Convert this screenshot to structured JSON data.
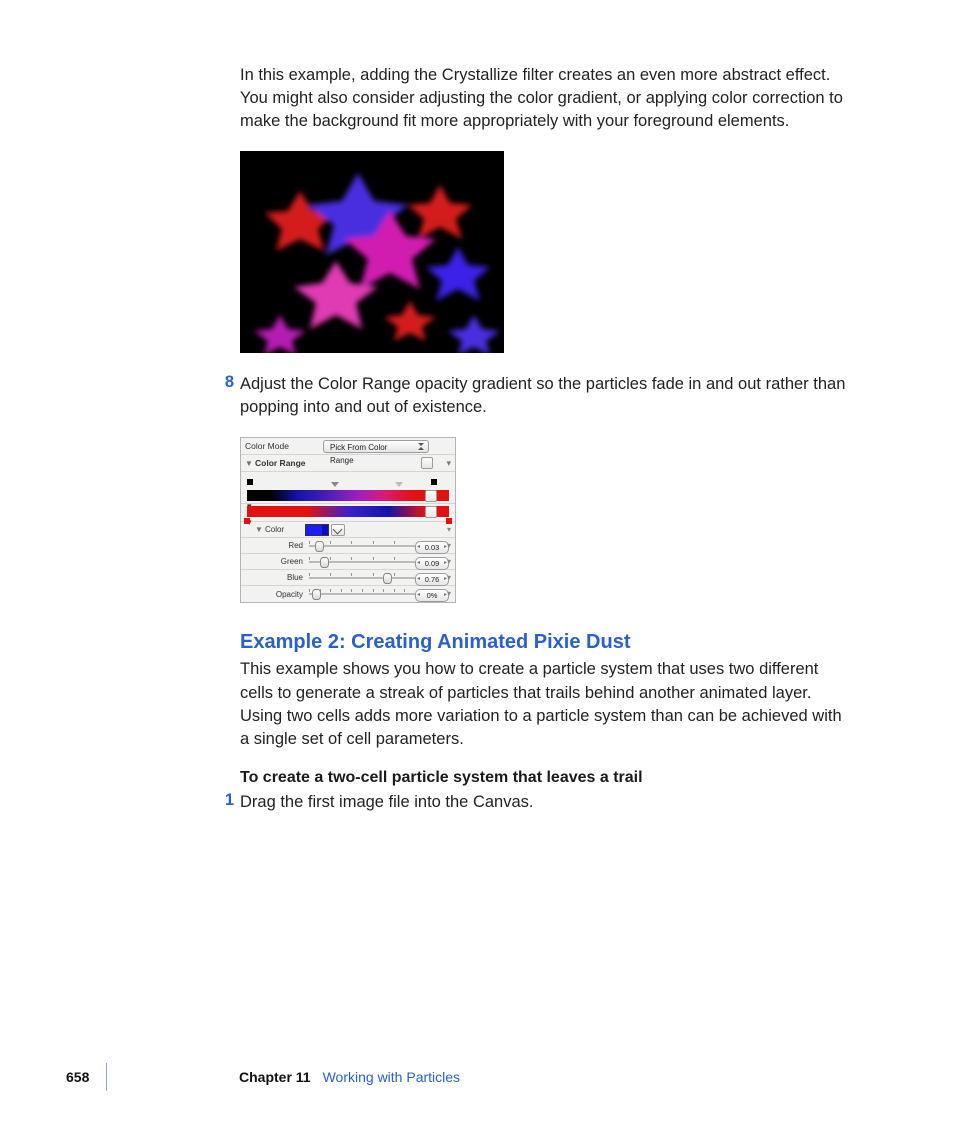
{
  "intro_paragraph": "In this example, adding the Crystallize filter creates an even more abstract effect. You might also consider adjusting the color gradient, or applying color correction to make the background fit more appropriately with your foreground elements.",
  "step8": {
    "num": "8",
    "text": "Adjust the Color Range opacity gradient so the particles fade in and out rather than popping into and out of existence."
  },
  "inspector": {
    "color_mode_label": "Color Mode",
    "color_mode_value": "Pick From Color Range",
    "color_range_label": "Color Range",
    "color_group_label": "Color",
    "params": {
      "red": {
        "label": "Red",
        "value": "0.03",
        "pos": 4
      },
      "green": {
        "label": "Green",
        "value": "0.09",
        "pos": 8
      },
      "blue": {
        "label": "Blue",
        "value": "0.76",
        "pos": 52
      },
      "opacity": {
        "label": "Opacity",
        "value": "0%",
        "pos": 2
      }
    }
  },
  "example2": {
    "heading": "Example 2: Creating Animated Pixie Dust",
    "paragraph": "This example shows you how to create a particle system that uses two different cells to generate a streak of particles that trails behind another animated layer. Using two cells adds more variation to a particle system than can be achieved with a single set of cell parameters.",
    "task_heading": "To create a two-cell particle system that leaves a trail",
    "step1_num": "1",
    "step1_text": "Drag the first image file into the Canvas."
  },
  "footer": {
    "page": "658",
    "chapter_label": "Chapter 11",
    "chapter_title": "Working with Particles"
  },
  "colors": {
    "link_blue": "#2a60c8"
  }
}
